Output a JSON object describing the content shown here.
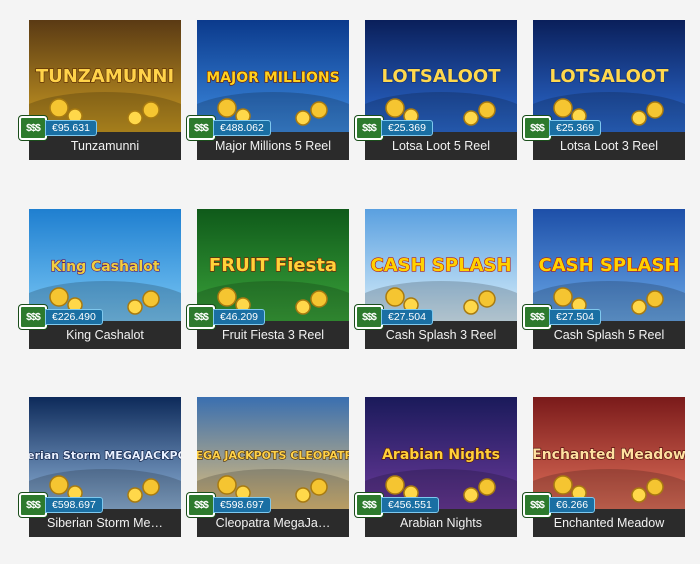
{
  "currency_icon": "$$$",
  "games": [
    {
      "title": "Tunzamunni",
      "logo": "TUNZAMUNNI",
      "jackpot": "€95.631",
      "bg": [
        "#5a3a14",
        "#c99a22"
      ],
      "logo_color": "#ffd34a",
      "logo_stroke": "#5a2a00"
    },
    {
      "title": "Major Millions 5 Reel",
      "logo": "MAJOR MILLIONS",
      "jackpot": "€488.062",
      "bg": [
        "#0b3a8c",
        "#3d8be0"
      ],
      "logo_color": "#ffd21f",
      "logo_stroke": "#6b1a00"
    },
    {
      "title": "Lotsa Loot 5 Reel",
      "logo": "LOTSALOOT",
      "jackpot": "€25.369",
      "bg": [
        "#0a1f5a",
        "#2c6bd1"
      ],
      "logo_color": "#ffd84d",
      "logo_stroke": "#0d2f7a"
    },
    {
      "title": "Lotsa Loot 3 Reel",
      "logo": "LOTSALOOT",
      "jackpot": "€25.369",
      "bg": [
        "#0a1f5a",
        "#2c6bd1"
      ],
      "logo_color": "#ffd84d",
      "logo_stroke": "#0d2f7a"
    },
    {
      "title": "King Cashalot",
      "logo": "King Cashalot",
      "jackpot": "€226.490",
      "bg": [
        "#1f7fd0",
        "#79c7f5"
      ],
      "logo_color": "#f0d040",
      "logo_stroke": "#5a1a6a"
    },
    {
      "title": "Fruit Fiesta 3 Reel",
      "logo": "FRUIT Fiesta",
      "jackpot": "€46.209",
      "bg": [
        "#0f5a1a",
        "#3aa23a"
      ],
      "logo_color": "#ffd23a",
      "logo_stroke": "#7a1a00"
    },
    {
      "title": "Cash Splash 3 Reel",
      "logo": "CASH SPLASH",
      "jackpot": "€27.504",
      "bg": [
        "#5aa0e0",
        "#d8eefa"
      ],
      "logo_color": "#ffd200",
      "logo_stroke": "#b01818"
    },
    {
      "title": "Cash Splash 5 Reel",
      "logo": "CASH SPLASH",
      "jackpot": "€27.504",
      "bg": [
        "#1d4fa8",
        "#6aa8e8"
      ],
      "logo_color": "#ffd200",
      "logo_stroke": "#b01818"
    },
    {
      "title": "Siberian Storm Me…",
      "logo": "Siberian Storm MEGAJACKPOTS",
      "jackpot": "€598.697",
      "bg": [
        "#0d2a5a",
        "#8fb3d9"
      ],
      "logo_color": "#e8f0ff",
      "logo_stroke": "#0a1a40"
    },
    {
      "title": "Cleopatra MegaJa…",
      "logo": "MEGA JACKPOTS CLEOPATRA",
      "jackpot": "€598.697",
      "bg": [
        "#3a6fb0",
        "#e2c07a"
      ],
      "logo_color": "#ffd24a",
      "logo_stroke": "#4a2a00"
    },
    {
      "title": "Arabian Nights",
      "logo": "Arabian Nights",
      "jackpot": "€456.551",
      "bg": [
        "#1a1a5a",
        "#6a3a9a"
      ],
      "logo_color": "#ffd03a",
      "logo_stroke": "#5a1a00"
    },
    {
      "title": "Enchanted Meadow",
      "logo": "Enchanted Meadow",
      "jackpot": "€6.266",
      "bg": [
        "#7a1a1a",
        "#e0705a"
      ],
      "logo_color": "#ffe0a0",
      "logo_stroke": "#4a0a0a"
    }
  ]
}
